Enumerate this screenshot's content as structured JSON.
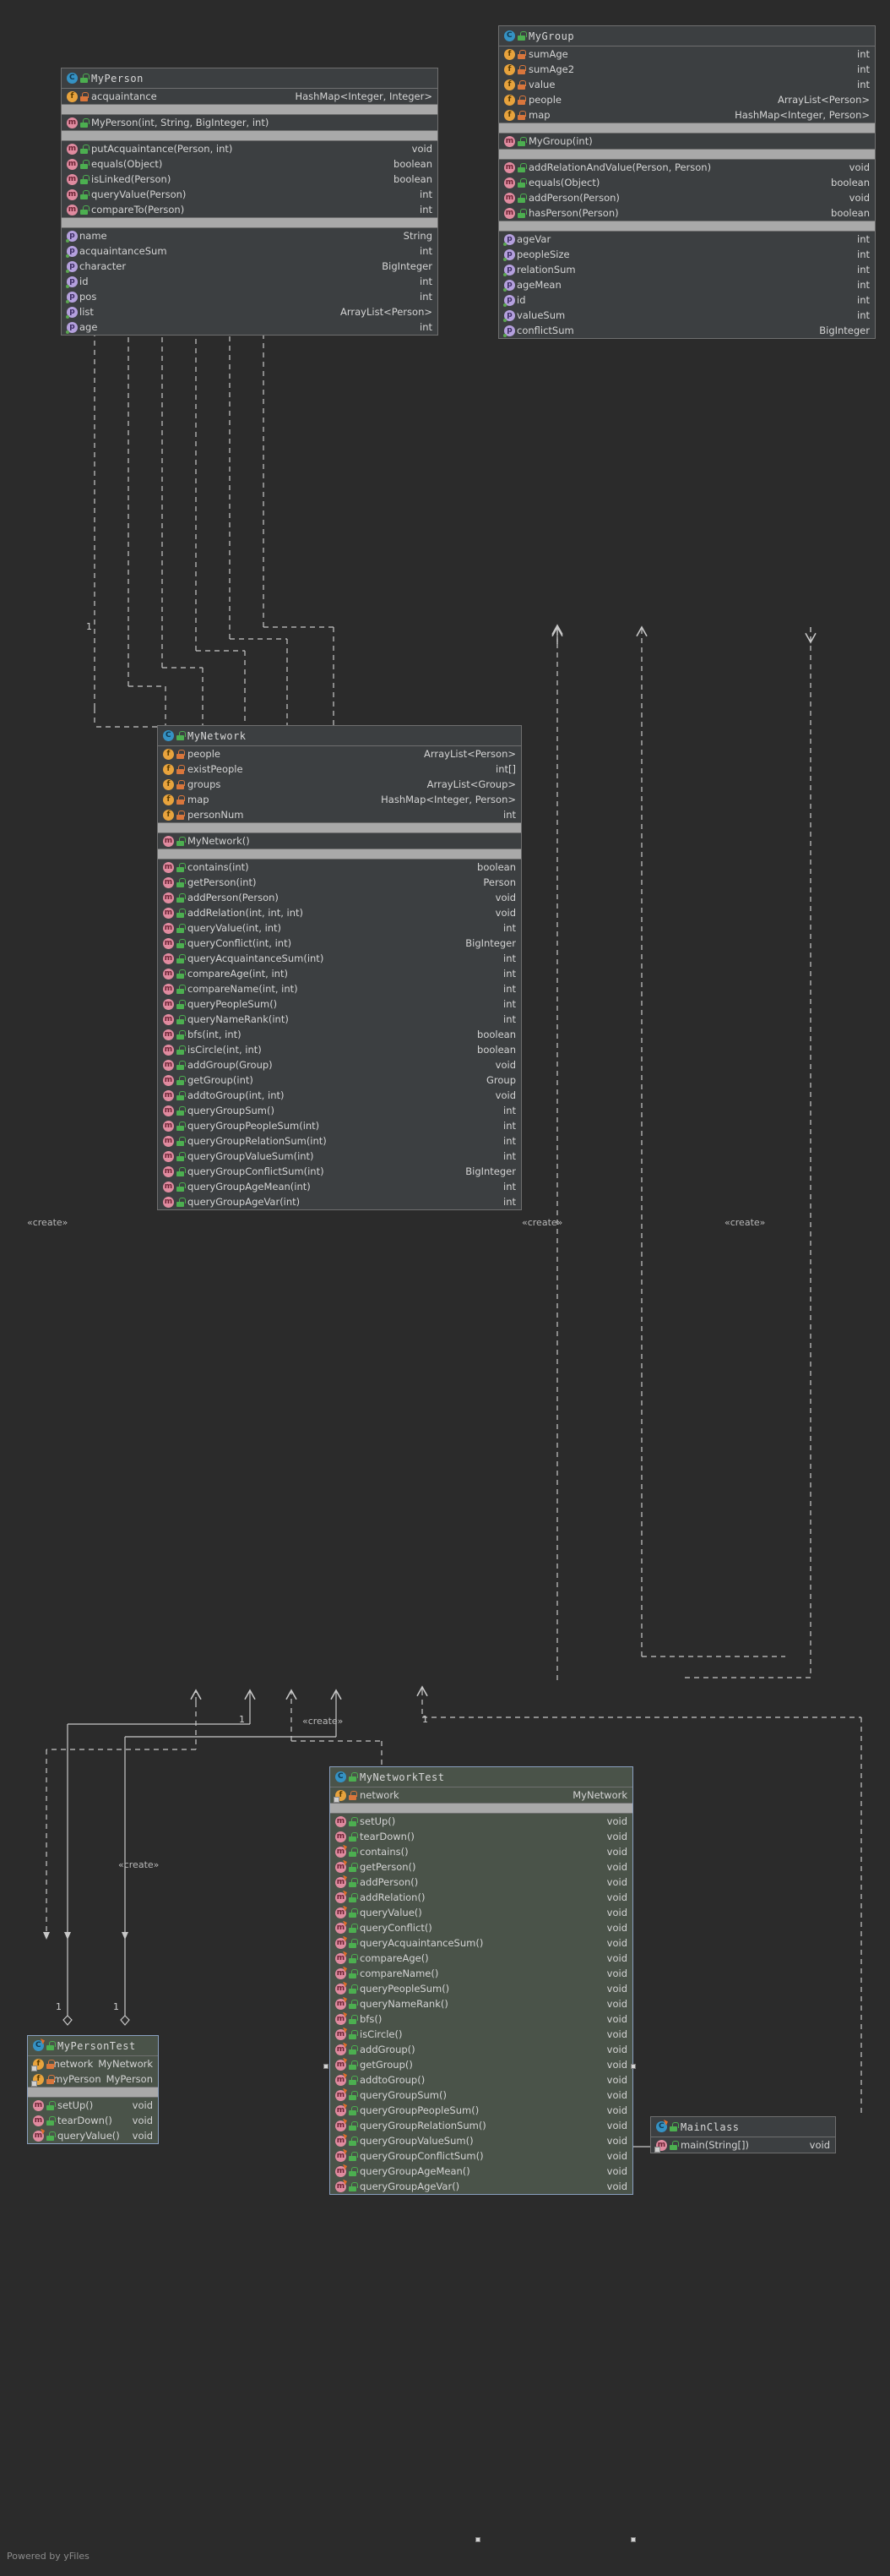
{
  "diagram": {
    "tool_watermark": "Powered by yFiles",
    "background_color": "#2b2b2b",
    "node_color": "#3c3f41",
    "test_node_color": "#4a5349",
    "border_color": "#6f6f6f",
    "selection_border_color": "#8aa0c0",
    "separator_color": "#a9a9a9",
    "text_color": "#d4d4d4"
  },
  "stereotypes": {
    "create_1": "«create»",
    "create_2": "«create»",
    "create_3": "«create»",
    "create_4": "«create»",
    "create_5": "«create»"
  },
  "multiplicities": {
    "m1": "1",
    "m2": "1",
    "m3": "1",
    "m4": "1",
    "m5": "1"
  },
  "classes": {
    "my_person": {
      "name": "MyPerson",
      "icon": "class-icon",
      "visibility_icon": "public-lock-icon",
      "fields": [
        {
          "icon": "field-icon",
          "visibility": "private",
          "name": "acquaintance",
          "type": "HashMap<Integer, Integer>"
        }
      ],
      "constructors": [
        {
          "icon": "method-icon",
          "visibility": "public",
          "name": "MyPerson(int, String, BigInteger, int)",
          "type": ""
        }
      ],
      "methods": [
        {
          "icon": "method-icon",
          "visibility": "public",
          "name": "putAcquaintance(Person, int)",
          "type": "void"
        },
        {
          "icon": "method-icon",
          "visibility": "public",
          "name": "equals(Object)",
          "type": "boolean"
        },
        {
          "icon": "method-icon",
          "visibility": "public",
          "name": "isLinked(Person)",
          "type": "boolean"
        },
        {
          "icon": "method-icon",
          "visibility": "public",
          "name": "queryValue(Person)",
          "type": "int"
        },
        {
          "icon": "method-icon",
          "visibility": "public",
          "name": "compareTo(Person)",
          "type": "int"
        }
      ],
      "properties": [
        {
          "icon": "property-icon",
          "name": "name",
          "type": "String"
        },
        {
          "icon": "property-icon",
          "name": "acquaintanceSum",
          "type": "int"
        },
        {
          "icon": "property-icon",
          "name": "character",
          "type": "BigInteger"
        },
        {
          "icon": "property-icon",
          "name": "id",
          "type": "int"
        },
        {
          "icon": "property-icon",
          "name": "pos",
          "type": "int"
        },
        {
          "icon": "property-icon",
          "name": "list",
          "type": "ArrayList<Person>"
        },
        {
          "icon": "property-icon",
          "name": "age",
          "type": "int"
        }
      ]
    },
    "my_group": {
      "name": "MyGroup",
      "icon": "class-icon",
      "visibility_icon": "public-lock-icon",
      "fields": [
        {
          "icon": "field-icon",
          "visibility": "private",
          "name": "sumAge",
          "type": "int"
        },
        {
          "icon": "field-icon",
          "visibility": "private",
          "name": "sumAge2",
          "type": "int"
        },
        {
          "icon": "field-icon",
          "visibility": "private",
          "name": "value",
          "type": "int"
        },
        {
          "icon": "field-icon",
          "visibility": "private",
          "name": "people",
          "type": "ArrayList<Person>"
        },
        {
          "icon": "field-icon",
          "visibility": "private",
          "name": "map",
          "type": "HashMap<Integer, Person>"
        }
      ],
      "constructors": [
        {
          "icon": "method-icon",
          "visibility": "public",
          "name": "MyGroup(int)",
          "type": ""
        }
      ],
      "methods": [
        {
          "icon": "method-icon",
          "visibility": "public",
          "name": "addRelationAndValue(Person, Person)",
          "type": "void"
        },
        {
          "icon": "method-icon",
          "visibility": "public",
          "name": "equals(Object)",
          "type": "boolean"
        },
        {
          "icon": "method-icon",
          "visibility": "public",
          "name": "addPerson(Person)",
          "type": "void"
        },
        {
          "icon": "method-icon",
          "visibility": "public",
          "name": "hasPerson(Person)",
          "type": "boolean"
        }
      ],
      "properties": [
        {
          "icon": "property-icon",
          "name": "ageVar",
          "type": "int"
        },
        {
          "icon": "property-icon",
          "name": "peopleSize",
          "type": "int"
        },
        {
          "icon": "property-icon",
          "name": "relationSum",
          "type": "int"
        },
        {
          "icon": "property-icon",
          "name": "ageMean",
          "type": "int"
        },
        {
          "icon": "property-icon",
          "name": "id",
          "type": "int"
        },
        {
          "icon": "property-icon",
          "name": "valueSum",
          "type": "int"
        },
        {
          "icon": "property-icon",
          "name": "conflictSum",
          "type": "BigInteger"
        }
      ]
    },
    "my_network": {
      "name": "MyNetwork",
      "icon": "class-icon",
      "visibility_icon": "public-lock-icon",
      "fields": [
        {
          "icon": "field-icon",
          "visibility": "private",
          "name": "people",
          "type": "ArrayList<Person>"
        },
        {
          "icon": "field-icon",
          "visibility": "private",
          "name": "existPeople",
          "type": "int[]"
        },
        {
          "icon": "field-icon",
          "visibility": "private",
          "name": "groups",
          "type": "ArrayList<Group>"
        },
        {
          "icon": "field-icon",
          "visibility": "private",
          "name": "map",
          "type": "HashMap<Integer, Person>"
        },
        {
          "icon": "field-icon",
          "visibility": "private",
          "name": "personNum",
          "type": "int"
        }
      ],
      "constructors": [
        {
          "icon": "method-icon",
          "visibility": "public",
          "name": "MyNetwork()",
          "type": ""
        }
      ],
      "methods": [
        {
          "icon": "method-icon",
          "visibility": "public",
          "name": "contains(int)",
          "type": "boolean"
        },
        {
          "icon": "method-icon",
          "visibility": "public",
          "name": "getPerson(int)",
          "type": "Person"
        },
        {
          "icon": "method-icon",
          "visibility": "public",
          "name": "addPerson(Person)",
          "type": "void"
        },
        {
          "icon": "method-icon",
          "visibility": "public",
          "name": "addRelation(int, int, int)",
          "type": "void"
        },
        {
          "icon": "method-icon",
          "visibility": "public",
          "name": "queryValue(int, int)",
          "type": "int"
        },
        {
          "icon": "method-icon",
          "visibility": "public",
          "name": "queryConflict(int, int)",
          "type": "BigInteger"
        },
        {
          "icon": "method-icon",
          "visibility": "public",
          "name": "queryAcquaintanceSum(int)",
          "type": "int"
        },
        {
          "icon": "method-icon",
          "visibility": "public",
          "name": "compareAge(int, int)",
          "type": "int"
        },
        {
          "icon": "method-icon",
          "visibility": "public",
          "name": "compareName(int, int)",
          "type": "int"
        },
        {
          "icon": "method-icon",
          "visibility": "public",
          "name": "queryPeopleSum()",
          "type": "int"
        },
        {
          "icon": "method-icon",
          "visibility": "public",
          "name": "queryNameRank(int)",
          "type": "int"
        },
        {
          "icon": "method-icon",
          "visibility": "public",
          "name": "bfs(int, int)",
          "type": "boolean"
        },
        {
          "icon": "method-icon",
          "visibility": "public",
          "name": "isCircle(int, int)",
          "type": "boolean"
        },
        {
          "icon": "method-icon",
          "visibility": "public",
          "name": "addGroup(Group)",
          "type": "void"
        },
        {
          "icon": "method-icon",
          "visibility": "public",
          "name": "getGroup(int)",
          "type": "Group"
        },
        {
          "icon": "method-icon",
          "visibility": "public",
          "name": "addtoGroup(int, int)",
          "type": "void"
        },
        {
          "icon": "method-icon",
          "visibility": "public",
          "name": "queryGroupSum()",
          "type": "int"
        },
        {
          "icon": "method-icon",
          "visibility": "public",
          "name": "queryGroupPeopleSum(int)",
          "type": "int"
        },
        {
          "icon": "method-icon",
          "visibility": "public",
          "name": "queryGroupRelationSum(int)",
          "type": "int"
        },
        {
          "icon": "method-icon",
          "visibility": "public",
          "name": "queryGroupValueSum(int)",
          "type": "int"
        },
        {
          "icon": "method-icon",
          "visibility": "public",
          "name": "queryGroupConflictSum(int)",
          "type": "BigInteger"
        },
        {
          "icon": "method-icon",
          "visibility": "public",
          "name": "queryGroupAgeMean(int)",
          "type": "int"
        },
        {
          "icon": "method-icon",
          "visibility": "public",
          "name": "queryGroupAgeVar(int)",
          "type": "int"
        }
      ]
    },
    "my_network_test": {
      "name": "MyNetworkTest",
      "icon": "class-icon",
      "selected": true,
      "fields": [
        {
          "icon": "field-icon",
          "visibility": "private",
          "name": "network",
          "type": "MyNetwork"
        }
      ],
      "methods": [
        {
          "icon": "method-icon",
          "visibility": "public",
          "name": "setUp()",
          "type": "void",
          "runnable": false
        },
        {
          "icon": "method-icon",
          "visibility": "public",
          "name": "tearDown()",
          "type": "void",
          "runnable": false
        },
        {
          "icon": "method-icon",
          "visibility": "public",
          "name": "contains()",
          "type": "void",
          "runnable": true
        },
        {
          "icon": "method-icon",
          "visibility": "public",
          "name": "getPerson()",
          "type": "void",
          "runnable": true
        },
        {
          "icon": "method-icon",
          "visibility": "public",
          "name": "addPerson()",
          "type": "void",
          "runnable": true
        },
        {
          "icon": "method-icon",
          "visibility": "public",
          "name": "addRelation()",
          "type": "void",
          "runnable": true
        },
        {
          "icon": "method-icon",
          "visibility": "public",
          "name": "queryValue()",
          "type": "void",
          "runnable": true
        },
        {
          "icon": "method-icon",
          "visibility": "public",
          "name": "queryConflict()",
          "type": "void",
          "runnable": true
        },
        {
          "icon": "method-icon",
          "visibility": "public",
          "name": "queryAcquaintanceSum()",
          "type": "void",
          "runnable": true
        },
        {
          "icon": "method-icon",
          "visibility": "public",
          "name": "compareAge()",
          "type": "void",
          "runnable": true
        },
        {
          "icon": "method-icon",
          "visibility": "public",
          "name": "compareName()",
          "type": "void",
          "runnable": true
        },
        {
          "icon": "method-icon",
          "visibility": "public",
          "name": "queryPeopleSum()",
          "type": "void",
          "runnable": true
        },
        {
          "icon": "method-icon",
          "visibility": "public",
          "name": "queryNameRank()",
          "type": "void",
          "runnable": true
        },
        {
          "icon": "method-icon",
          "visibility": "public",
          "name": "bfs()",
          "type": "void",
          "runnable": true
        },
        {
          "icon": "method-icon",
          "visibility": "public",
          "name": "isCircle()",
          "type": "void",
          "runnable": true
        },
        {
          "icon": "method-icon",
          "visibility": "public",
          "name": "addGroup()",
          "type": "void",
          "runnable": true
        },
        {
          "icon": "method-icon",
          "visibility": "public",
          "name": "getGroup()",
          "type": "void",
          "runnable": true
        },
        {
          "icon": "method-icon",
          "visibility": "public",
          "name": "addtoGroup()",
          "type": "void",
          "runnable": true
        },
        {
          "icon": "method-icon",
          "visibility": "public",
          "name": "queryGroupSum()",
          "type": "void",
          "runnable": true
        },
        {
          "icon": "method-icon",
          "visibility": "public",
          "name": "queryGroupPeopleSum()",
          "type": "void",
          "runnable": true
        },
        {
          "icon": "method-icon",
          "visibility": "public",
          "name": "queryGroupRelationSum()",
          "type": "void",
          "runnable": true
        },
        {
          "icon": "method-icon",
          "visibility": "public",
          "name": "queryGroupValueSum()",
          "type": "void",
          "runnable": true
        },
        {
          "icon": "method-icon",
          "visibility": "public",
          "name": "queryGroupConflictSum()",
          "type": "void",
          "runnable": true
        },
        {
          "icon": "method-icon",
          "visibility": "public",
          "name": "queryGroupAgeMean()",
          "type": "void",
          "runnable": true
        },
        {
          "icon": "method-icon",
          "visibility": "public",
          "name": "queryGroupAgeVar()",
          "type": "void",
          "runnable": true
        }
      ]
    },
    "my_person_test": {
      "name": "MyPersonTest",
      "icon": "class-icon",
      "fields": [
        {
          "icon": "field-icon",
          "visibility": "private",
          "name": "network",
          "type": "MyNetwork"
        },
        {
          "icon": "field-icon",
          "visibility": "private",
          "name": "myPerson",
          "type": "MyPerson"
        }
      ],
      "methods": [
        {
          "icon": "method-icon",
          "visibility": "public",
          "name": "setUp()",
          "type": "void",
          "runnable": false
        },
        {
          "icon": "method-icon",
          "visibility": "public",
          "name": "tearDown()",
          "type": "void",
          "runnable": false
        },
        {
          "icon": "method-icon",
          "visibility": "public",
          "name": "queryValue()",
          "type": "void",
          "runnable": true
        }
      ]
    },
    "main_class": {
      "name": "MainClass",
      "icon": "class-icon",
      "methods": [
        {
          "icon": "method-icon",
          "visibility": "public",
          "name": "main(String[])",
          "type": "void"
        }
      ]
    }
  }
}
